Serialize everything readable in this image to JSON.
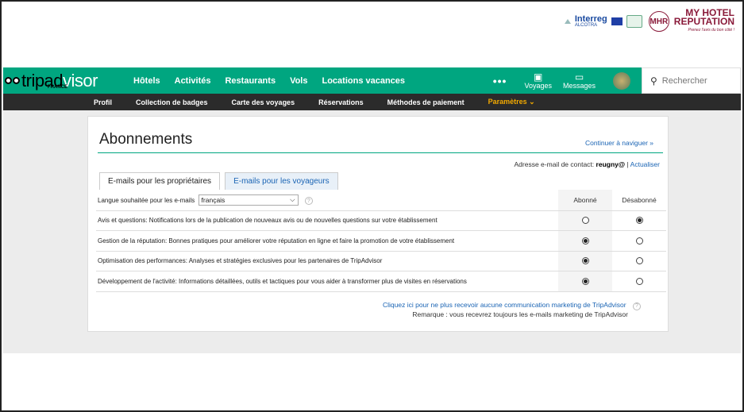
{
  "header": {
    "interreg": {
      "name": "Interreg",
      "sub": "ALCOTRA"
    },
    "mhr": {
      "mark": "MHR",
      "line1": "MY HOTEL",
      "line2": "REPUTATION",
      "tagline": "Prenez l'avis du bon côté !"
    }
  },
  "nav": {
    "brand_dark": "tripad",
    "brand_light": "visor",
    "brand_country": "FRANCE",
    "links": [
      "Hôtels",
      "Activités",
      "Restaurants",
      "Vols",
      "Locations vacances"
    ],
    "more": "•••",
    "voyages": "Voyages",
    "messages": "Messages",
    "search_placeholder": "Rechercher"
  },
  "subnav": {
    "items": [
      "Profil",
      "Collection de badges",
      "Carte des voyages",
      "Réservations",
      "Méthodes de paiement",
      "Paramètres ⌄"
    ]
  },
  "page": {
    "title": "Abonnements",
    "continue_link": "Continuer à naviguer »",
    "contact_label": "Adresse e-mail de contact:",
    "contact_value": "reugny@",
    "separator": "|",
    "refresh_link": "Actualiser",
    "tabs": [
      "E-mails pour les propriétaires",
      "E-mails pour les voyageurs"
    ]
  },
  "table": {
    "lang_label": "Langue souhaitée pour les e-mails",
    "lang_value": "français",
    "col_subscribed": "Abonné",
    "col_unsubscribed": "Désabonné",
    "rows": [
      {
        "title": "Avis et questions:",
        "text": " Notifications lors de la publication de nouveaux avis ou de nouvelles questions sur votre établissement",
        "subscribed": false
      },
      {
        "title": "Gestion de la réputation:",
        "text": " Bonnes pratiques pour améliorer votre réputation en ligne et faire la promotion de votre établissement",
        "subscribed": true
      },
      {
        "title": "Optimisation des performances:",
        "text": " Analyses et stratégies exclusives pour les partenaires de TripAdvisor",
        "subscribed": true
      },
      {
        "title": "Développement de l'activité:",
        "text": " Informations détaillées, outils et tactiques pour vous aider à transformer plus de visites en réservations",
        "subscribed": true
      }
    ]
  },
  "footer": {
    "unsubscribe_all": "Cliquez ici pour ne plus recevoir aucune communication marketing de TripAdvisor",
    "note": "Remarque : vous recevrez toujours les e-mails marketing de TripAdvisor"
  }
}
